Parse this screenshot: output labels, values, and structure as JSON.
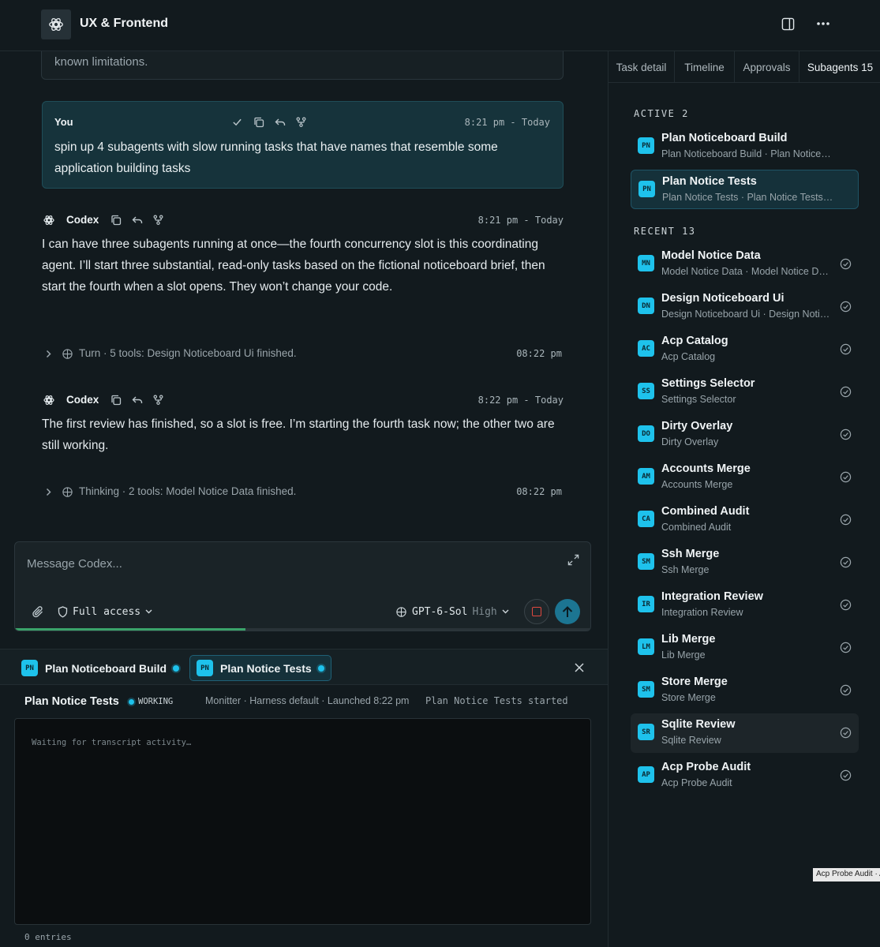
{
  "header": {
    "title": "UX & Frontend",
    "icons": [
      "openai-logo-icon",
      "panel-toggle-icon",
      "more-icon"
    ]
  },
  "chat": {
    "previous_text": "known limitations.",
    "user_message": {
      "author": "You",
      "time": "8:21 pm - Today",
      "text": "spin up 4 subagents with slow running tasks that have names that resemble some application building tasks"
    },
    "codex_messages": [
      {
        "author": "Codex",
        "time": "8:21 pm - Today",
        "text": "I can have three subagents running at once—the fourth concurrency slot is this coordinating agent. I’ll start three substantial, read-only tasks based on the fictional noticeboard brief, then start the fourth when a slot opens. They won’t change your code."
      },
      {
        "author": "Codex",
        "time": "8:22 pm - Today",
        "text": "The first review has finished, so a slot is free. I’m starting the fourth task now; the other two are still working."
      }
    ],
    "turns": [
      {
        "text": "Turn · 5 tools: Design Noticeboard Ui finished.",
        "time": "08:22 pm"
      },
      {
        "text": "Thinking · 2 tools: Model Notice Data finished.",
        "time": "08:22 pm"
      }
    ]
  },
  "composer": {
    "placeholder": "Message Codex...",
    "access_label": "Full access",
    "model_name": "GPT-6-Sol",
    "model_level": "High",
    "progress": 0.4
  },
  "agent_tabs": [
    {
      "badge": "PN",
      "label": "Plan Noticeboard Build",
      "active": false
    },
    {
      "badge": "PN",
      "label": "Plan Notice Tests",
      "active": true
    }
  ],
  "agent_detail": {
    "title": "Plan Notice Tests",
    "status": "WORKING",
    "meta": "Monitter · Harness default · Launched 8:22 pm",
    "started": "Plan Notice Tests started",
    "transcript_placeholder": "Waiting for transcript activity…",
    "entries": "0 entries"
  },
  "right_panel": {
    "tabs": [
      {
        "label": "Task detail",
        "active": false
      },
      {
        "label": "Timeline",
        "active": false
      },
      {
        "label": "Approvals",
        "active": false
      },
      {
        "label": "Subagents 15",
        "active": true
      }
    ],
    "active_label": "ACTIVE 2",
    "recent_label": "RECENT 13",
    "active": [
      {
        "badge": "PN",
        "name": "Plan Noticeboard Build",
        "sub": "Plan Noticeboard Build · Plan Noticeboard Build started"
      },
      {
        "badge": "PN",
        "name": "Plan Notice Tests",
        "sub": "Plan Notice Tests · Plan Notice Tests started"
      }
    ],
    "recent": [
      {
        "badge": "MN",
        "name": "Model Notice Data",
        "sub": "Model Notice Data · Model Notice Data finished"
      },
      {
        "badge": "DN",
        "name": "Design Noticeboard Ui",
        "sub": "Design Noticeboard Ui · Design Noticeboard Ui finished"
      },
      {
        "badge": "AC",
        "name": "Acp Catalog",
        "sub": "Acp Catalog"
      },
      {
        "badge": "SS",
        "name": "Settings Selector",
        "sub": "Settings Selector"
      },
      {
        "badge": "DO",
        "name": "Dirty Overlay",
        "sub": "Dirty Overlay"
      },
      {
        "badge": "AM",
        "name": "Accounts Merge",
        "sub": "Accounts Merge"
      },
      {
        "badge": "CA",
        "name": "Combined Audit",
        "sub": "Combined Audit"
      },
      {
        "badge": "SM",
        "name": "Ssh Merge",
        "sub": "Ssh Merge"
      },
      {
        "badge": "IR",
        "name": "Integration Review",
        "sub": "Integration Review"
      },
      {
        "badge": "LM",
        "name": "Lib Merge",
        "sub": "Lib Merge"
      },
      {
        "badge": "SM",
        "name": "Store Merge",
        "sub": "Store Merge"
      },
      {
        "badge": "SR",
        "name": "Sqlite Review",
        "sub": "Sqlite Review"
      },
      {
        "badge": "AP",
        "name": "Acp Probe Audit",
        "sub": "Acp Probe Audit"
      }
    ]
  },
  "tooltip": "Acp Probe Audit · Acp Probe Audit",
  "colors": {
    "background": "#121a1e",
    "accent": "#1ec2ec",
    "user_card": "#16333b",
    "send_button": "#1c7592",
    "stop": "#e0483f",
    "progress": "#3aa36a"
  }
}
